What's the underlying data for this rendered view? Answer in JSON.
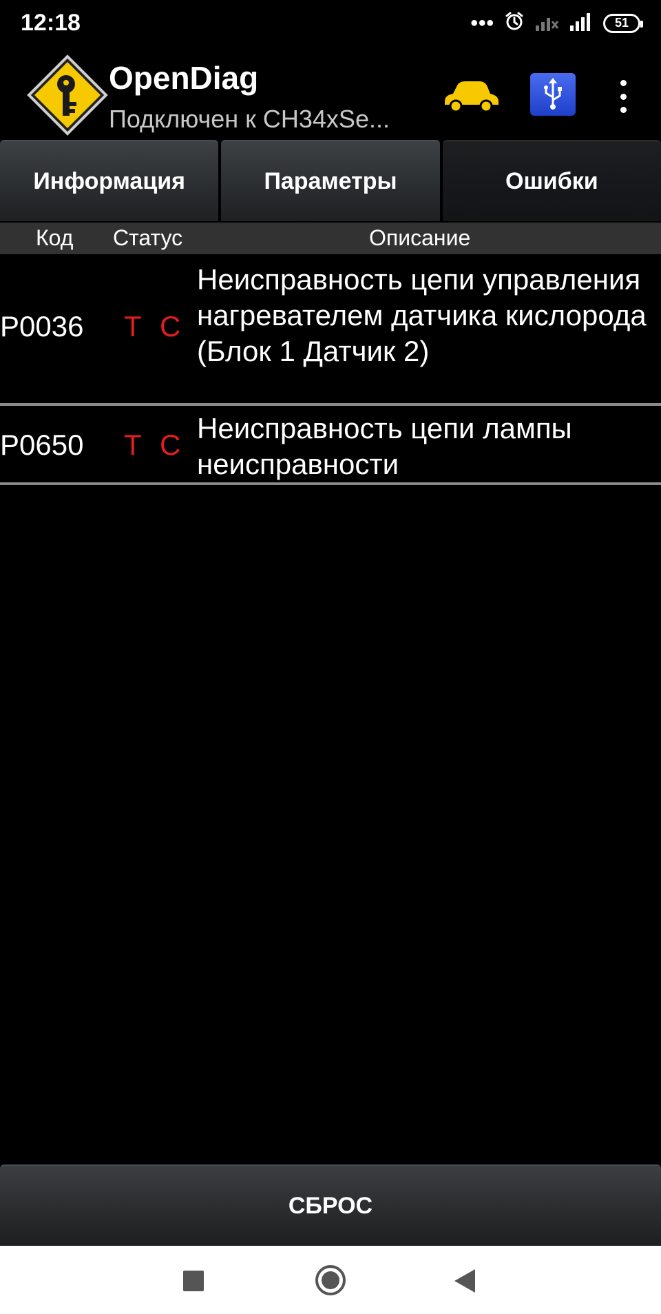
{
  "status_bar": {
    "time": "12:18",
    "more_indicator": "•••",
    "battery_level": "51",
    "icons": [
      "alarm-icon",
      "signal-weak-icon",
      "signal-icon",
      "battery-icon"
    ]
  },
  "app_bar": {
    "title": "OpenDiag",
    "subtitle": "Подключен к CH34xSe...",
    "icons": [
      "app-logo-icon",
      "car-icon",
      "usb-icon",
      "overflow-menu-icon"
    ],
    "colors": {
      "logo": "#f7c900",
      "car": "#f7c900",
      "usb": "#2f54e0"
    }
  },
  "tabs": [
    {
      "label": "Информация",
      "active": false
    },
    {
      "label": "Параметры",
      "active": false
    },
    {
      "label": "Ошибки",
      "active": true
    }
  ],
  "table": {
    "columns": {
      "code": "Код",
      "status": "Статус",
      "description": "Описание"
    },
    "rows": [
      {
        "code": "P0036",
        "status_t": "T",
        "status_c": "C",
        "description": "Неисправность цепи управления нагревателем датчика кислорода (Блок 1 Датчик 2)"
      },
      {
        "code": "P0650",
        "status_t": "T",
        "status_c": "C",
        "description": "Неисправность цепи лампы неисправности"
      }
    ],
    "status_color": "#e31c1c"
  },
  "reset_button": {
    "label": "СБРОС"
  },
  "nav_bar": {
    "icons": [
      "recents-icon",
      "home-icon",
      "back-icon"
    ]
  }
}
